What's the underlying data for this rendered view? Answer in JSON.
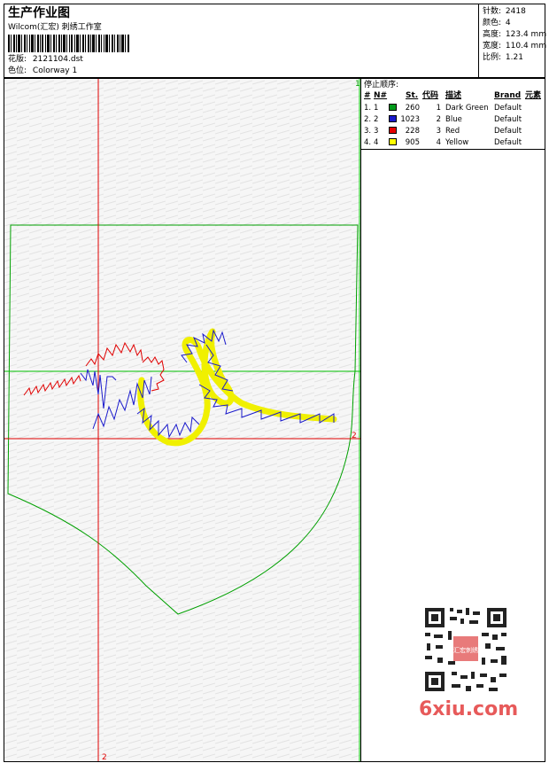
{
  "header": {
    "title": "生产作业图",
    "company": "Wilcom(汇宏) 刺绣工作室",
    "design_label": "花版:",
    "design_value": "2121104.dst",
    "colorway_label": "色位:",
    "colorway_value": "Colorway 1"
  },
  "stats": {
    "stitches_label": "针数:",
    "stitches_value": "2418",
    "colors_label": "颜色:",
    "colors_value": "4",
    "height_label": "高度:",
    "height_value": "123.4 mm",
    "width_label": "宽度:",
    "width_value": "110.4 mm",
    "ratio_label": "比例:",
    "ratio_value": "1.21"
  },
  "design": {
    "marker_top": "1",
    "marker_right": "2",
    "marker_bottom": "2"
  },
  "stop_sequence": {
    "title": "停止顺序:",
    "columns": [
      "#",
      "N#",
      "St.",
      "代码",
      "描述",
      "Brand",
      "元素"
    ],
    "rows": [
      {
        "seq": "1.",
        "n": "1",
        "color": "#009a1a",
        "st": "260",
        "code": "1",
        "desc": "Dark Green",
        "brand": "Default"
      },
      {
        "seq": "2.",
        "n": "2",
        "color": "#1a1acc",
        "st": "1023",
        "code": "2",
        "desc": "Blue",
        "brand": "Default"
      },
      {
        "seq": "3.",
        "n": "3",
        "color": "#e60000",
        "st": "228",
        "code": "3",
        "desc": "Red",
        "brand": "Default"
      },
      {
        "seq": "4.",
        "n": "4",
        "color": "#ffff00",
        "st": "905",
        "code": "4",
        "desc": "Yellow",
        "brand": "Default"
      }
    ]
  },
  "watermark": {
    "text": "6xiu.com",
    "stamp_text": "汇宏刺绣",
    "qr_icon": "qr-code-icon"
  },
  "colors": {
    "frame_green": "#00a000",
    "guide_red": "#e00000",
    "guide_green": "#00c000"
  }
}
